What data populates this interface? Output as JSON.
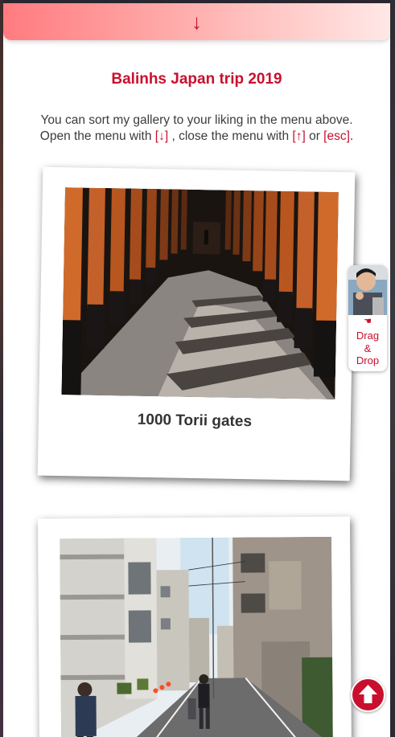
{
  "menu": {
    "toggle_glyph": "↓",
    "accent_color": "#c8102e",
    "gradient_colors": [
      "#ff7b7f",
      "#ffe8e6"
    ]
  },
  "title": "Balinhs Japan trip 2019",
  "intro": {
    "line1": "You can sort my gallery to your liking in the menu above.",
    "line2_prefix": "Open the menu with ",
    "open_key": "[↓]",
    "line2_middle": " , close the menu with ",
    "close_key": "[↑]",
    "or_text": " or ",
    "esc_key": "[esc]",
    "line2_suffix": "."
  },
  "gallery": {
    "items": [
      {
        "caption": "1000 Torii gates",
        "image": "torii-tunnel-photo"
      },
      {
        "caption": "",
        "image": "tokyo-alley-photo"
      }
    ]
  },
  "drag_drop": {
    "hand_glyph": "☚",
    "line1": "Drag",
    "line2": "&",
    "line3": "Drop"
  },
  "scroll_top": {
    "icon": "arrow-up-circle-icon"
  }
}
